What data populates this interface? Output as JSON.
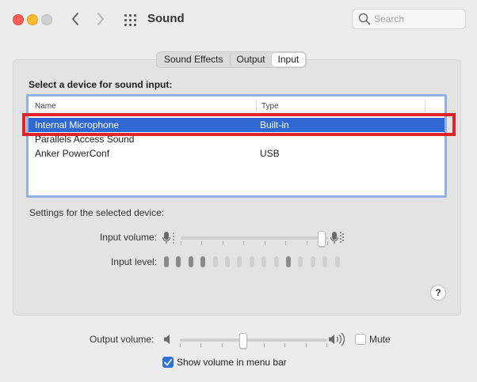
{
  "window": {
    "title": "Sound",
    "traffic_lights": [
      "close",
      "minimize",
      "zoom"
    ]
  },
  "toolbar": {
    "back_icon": "chevron-left-icon",
    "forward_icon": "chevron-right-icon",
    "grid_icon": "show-all-grid-icon"
  },
  "search": {
    "placeholder": "Search",
    "value": ""
  },
  "tabs": [
    {
      "label": "Sound Effects",
      "active": false
    },
    {
      "label": "Output",
      "active": false
    },
    {
      "label": "Input",
      "active": true
    }
  ],
  "input": {
    "section_label": "Select a device for sound input:",
    "columns": [
      "Name",
      "Type"
    ],
    "devices": [
      {
        "name": "Internal Microphone",
        "type": "Built-in",
        "selected": true
      },
      {
        "name": "Parallels Access Sound",
        "type": "",
        "selected": false
      },
      {
        "name": "Anker PowerConf",
        "type": "USB",
        "selected": false
      }
    ],
    "settings_label": "Settings for the selected device:",
    "input_volume_label": "Input volume:",
    "input_volume_fraction": 0.97,
    "input_level_label": "Input level:",
    "input_level_active_bars": 4,
    "input_level_total_bars": 15,
    "input_level_peak_bar": 10
  },
  "help_label": "?",
  "output": {
    "volume_label": "Output volume:",
    "volume_fraction": 0.42,
    "mute_label": "Mute",
    "mute_checked": false,
    "show_volume_label": "Show volume in menu bar",
    "show_volume_checked": true
  },
  "colors": {
    "selection": "#2f68d4",
    "highlight_annotation": "#e0232a",
    "checkbox_accent": "#2f6fd8"
  }
}
